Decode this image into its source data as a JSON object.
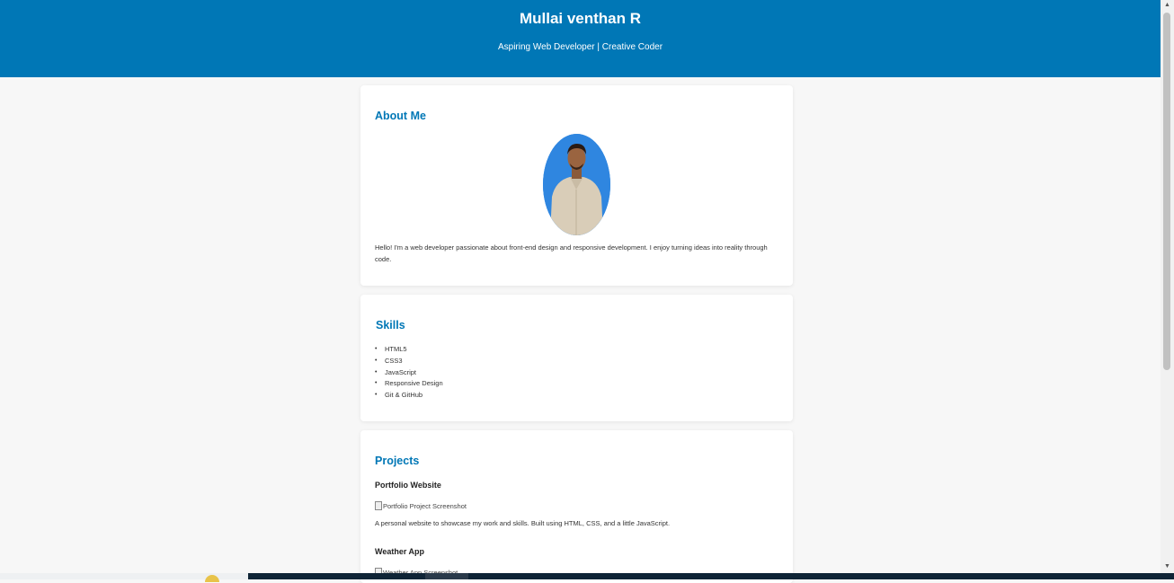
{
  "header": {
    "title": "Mullai venthan R",
    "subtitle": "Aspiring Web Developer | Creative Coder"
  },
  "about": {
    "heading": "About Me",
    "text": "Hello! I'm a web developer passionate about front-end design and responsive development. I enjoy turning ideas into reality through code."
  },
  "skills": {
    "heading": "Skills",
    "items": [
      "HTML5",
      "CSS3",
      "JavaScript",
      "Responsive Design",
      "Git & GitHub"
    ]
  },
  "projects": {
    "heading": "Projects",
    "items": [
      {
        "title": "Portfolio Website",
        "image_alt": "Portfolio Project Screenshot",
        "description": "A personal website to showcase my work and skills. Built using HTML, CSS, and a little JavaScript."
      },
      {
        "title": "Weather App",
        "image_alt": "Weather App Screenshot"
      }
    ]
  },
  "colors": {
    "accent": "#0077b6",
    "background": "#f7f7f7",
    "avatar_bg": "#2f86e0"
  }
}
